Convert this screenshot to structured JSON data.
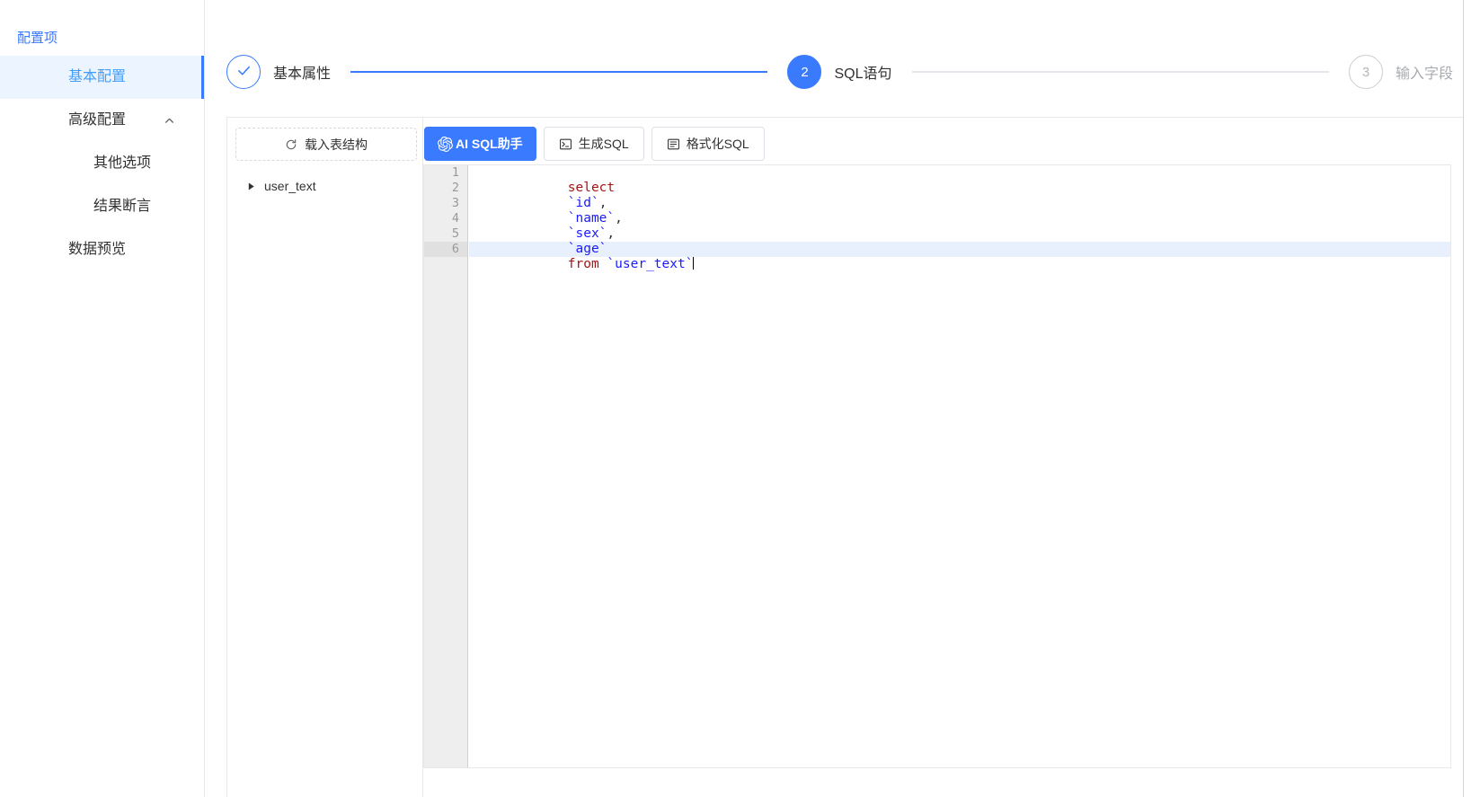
{
  "sidebar": {
    "breadcrumb": "配置项",
    "items": [
      {
        "label": "基本配置",
        "level": 1,
        "active": true,
        "arrow": ""
      },
      {
        "label": "高级配置",
        "level": 1,
        "active": false,
        "arrow": "chevron-up-icon"
      },
      {
        "label": "其他选项",
        "level": 2,
        "active": false,
        "arrow": ""
      },
      {
        "label": "结果断言",
        "level": 2,
        "active": false,
        "arrow": ""
      },
      {
        "label": "数据预览",
        "level": 1,
        "active": false,
        "arrow": ""
      }
    ]
  },
  "stepper": {
    "steps": [
      {
        "index": "1",
        "label": "基本属性",
        "state": "done",
        "icon": "check-icon"
      },
      {
        "index": "2",
        "label": "SQL语句",
        "state": "active",
        "icon": ""
      },
      {
        "index": "3",
        "label": "输入字段",
        "state": "todo",
        "icon": ""
      }
    ]
  },
  "table_panel": {
    "load_button": {
      "label": "载入表结构",
      "icon": "refresh-icon"
    },
    "tree": [
      {
        "label": "user_text",
        "expanded": false,
        "icon": "caret-right-icon"
      }
    ]
  },
  "toolbar": {
    "buttons": [
      {
        "label": "AI SQL助手",
        "style": "primary",
        "icon": "openai-swirl-icon"
      },
      {
        "label": "生成SQL",
        "style": "plain",
        "icon": "console-icon"
      },
      {
        "label": "格式化SQL",
        "style": "plain",
        "icon": "format-list-icon"
      }
    ]
  },
  "editor": {
    "line_numbers": [
      "1",
      "2",
      "3",
      "4",
      "5",
      "6"
    ],
    "active_line": 6,
    "lines": [
      {
        "n": "1",
        "text": "select",
        "kw": "select",
        "id": ""
      },
      {
        "n": "2",
        "text": "`id`,",
        "kw": "",
        "id": "`id`"
      },
      {
        "n": "3",
        "text": "`name`,",
        "kw": "",
        "id": "`name`"
      },
      {
        "n": "4",
        "text": "`sex`,",
        "kw": "",
        "id": "`sex`"
      },
      {
        "n": "5",
        "text": "`age`",
        "kw": "",
        "id": "`age`"
      },
      {
        "n": "6",
        "text": "from `user_text`",
        "kw": "from",
        "id": "`user_text`"
      }
    ],
    "full_sql": "select\n`id`,\n`name`,\n`sex`,\n`age`\nfrom `user_text`"
  },
  "colors": {
    "accent": "#3a7afe",
    "active_nav_bg": "#ecf5ff",
    "active_line_bg": "#e8f0fe",
    "gutter_bg": "#eeeeee",
    "keyword": "#a31515",
    "identifier": "#1a1aff",
    "border": "#e8e8e8"
  }
}
